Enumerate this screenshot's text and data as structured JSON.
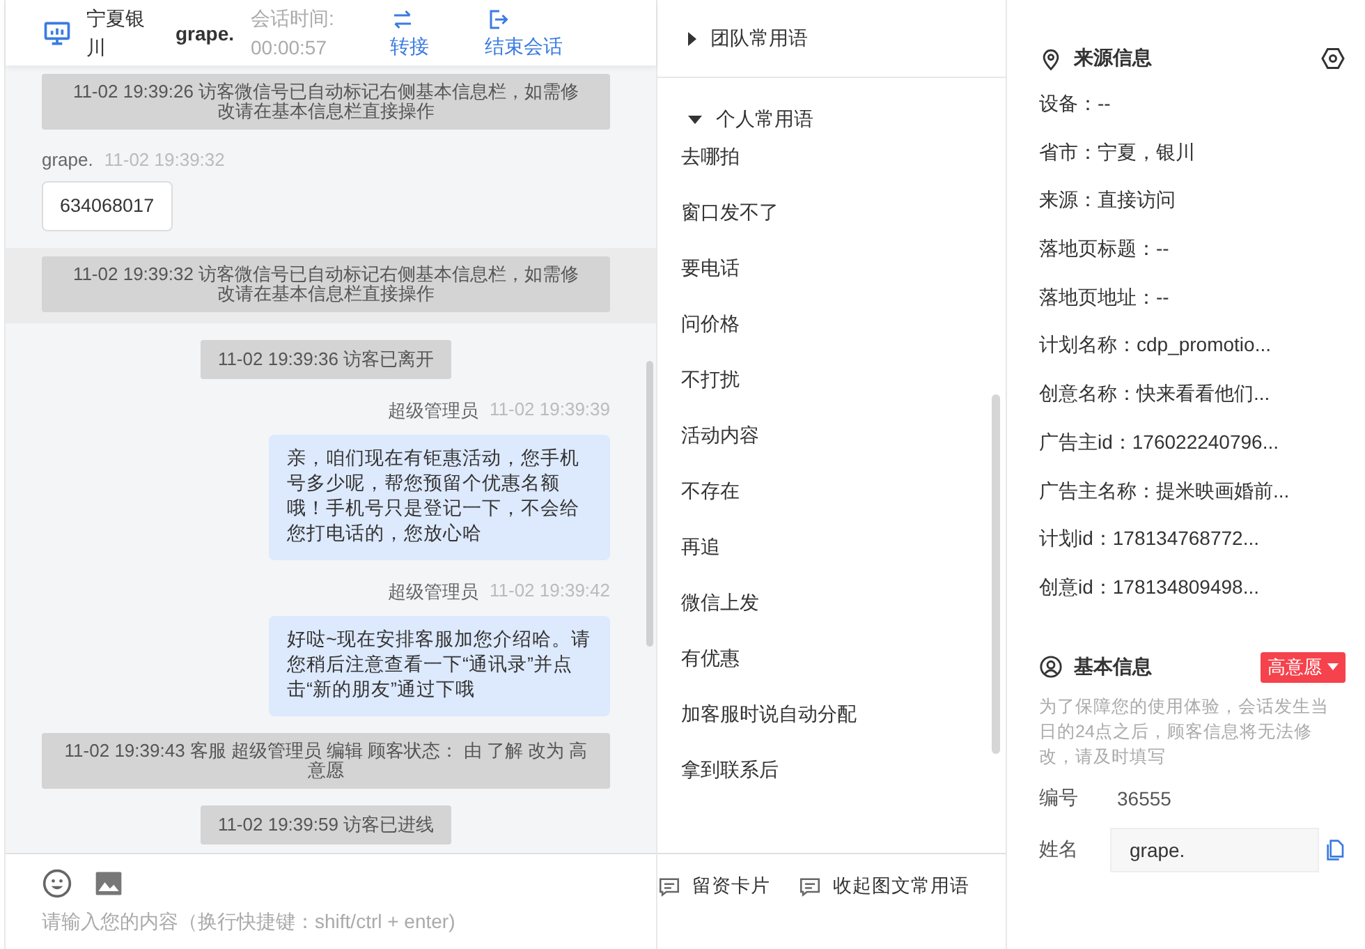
{
  "chat": {
    "header": {
      "location": "宁夏银川",
      "visitor": "grape.",
      "duration_label": "会话时间:",
      "duration": "00:00:57",
      "actions": [
        {
          "kind": "transfer",
          "label": "转接"
        },
        {
          "kind": "end",
          "label": "结束会话"
        }
      ]
    },
    "messages": [
      {
        "kind": "system",
        "text": "11-02 19:39:26 访客微信号已自动标记右侧基本信息栏，如需修改请在基本信息栏直接操作",
        "highlighted": false
      },
      {
        "kind": "visitor",
        "sender": "grape.",
        "time": "11-02 19:39:32",
        "text": "634068017"
      },
      {
        "kind": "system",
        "text": "11-02 19:39:32 访客微信号已自动标记右侧基本信息栏，如需修改请在基本信息栏直接操作",
        "highlighted": true
      },
      {
        "kind": "notice",
        "text": "11-02 19:39:36 访客已离开",
        "highlighted": false
      },
      {
        "kind": "agent",
        "sender": "超级管理员",
        "time": "11-02 19:39:39",
        "text": "亲，咱们现在有钜惠活动，您手机号多少呢，帮您预留个优惠名额哦！手机号只是登记一下，不会给您打电话的，您放心哈"
      },
      {
        "kind": "agent",
        "sender": "超级管理员",
        "time": "11-02 19:39:42",
        "text": "好哒~现在安排客服加您介绍哈。请您稍后注意查看一下“通讯录”并点击“新的朋友”通过下哦"
      },
      {
        "kind": "system",
        "text": "11-02 19:39:43 客服 超级管理员 编辑 顾客状态： 由 了解 改为 高意愿",
        "highlighted": false
      },
      {
        "kind": "notice",
        "text": "11-02 19:39:59 访客已进线",
        "highlighted": false
      }
    ],
    "input": {
      "placeholder": "请输入您的内容（换行快捷键：shift/ctrl + enter)"
    }
  },
  "phrases": {
    "groups": [
      {
        "title": "团队常用语",
        "expanded": false
      },
      {
        "title": "个人常用语",
        "expanded": true,
        "items": [
          "去哪拍",
          "窗口发不了",
          "要电话",
          "问价格",
          "不打扰",
          "活动内容",
          "不存在",
          "再追",
          "微信上发",
          "有优惠",
          "加客服时说自动分配",
          "拿到联系后"
        ]
      }
    ],
    "footer": [
      {
        "label": "留资卡片"
      },
      {
        "label": "收起图文常用语"
      }
    ]
  },
  "info": {
    "source": {
      "title": "来源信息",
      "rows": [
        "设备：--",
        "省市：宁夏，银川",
        "来源：直接访问",
        "落地页标题：--",
        "落地页地址：--",
        "计划名称：cdp_promotio...",
        "创意名称：快来看看他们...",
        "广告主id：176022240796...",
        "广告主名称：提米映画婚前...",
        "计划id：178134768772...",
        "创意id：178134809498..."
      ]
    },
    "basic": {
      "title": "基本信息",
      "tag": "高意愿",
      "note": "为了保障您的使用体验，会话发生当日的24点之后，顾客信息将无法修改，请及时填写",
      "fields": [
        {
          "kind": "text",
          "label": "编号",
          "value": "36555"
        },
        {
          "kind": "input",
          "label": "姓名",
          "value": "grape."
        }
      ]
    }
  }
}
